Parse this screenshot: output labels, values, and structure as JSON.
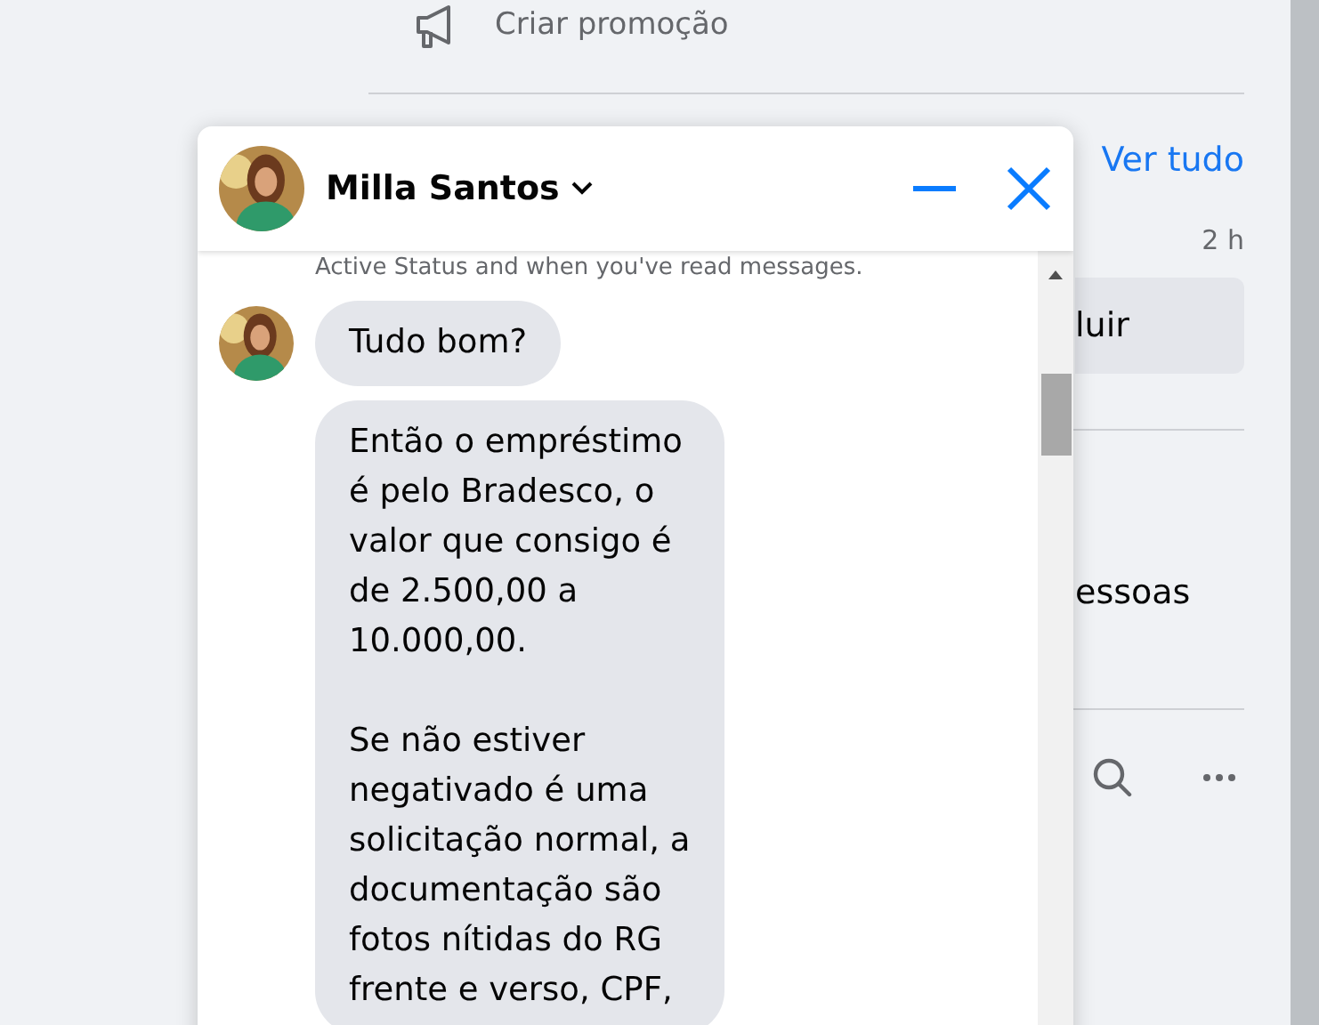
{
  "page": {
    "promo": "Criar promoção",
    "see_all": "Ver tudo",
    "time": "2 h",
    "button": "luir",
    "text": "essoas"
  },
  "chat": {
    "name": "Milla Santos",
    "notice": "Active Status and when you've read messages.",
    "messages": [
      {
        "text": "Tudo bom?",
        "show_avatar": true
      },
      {
        "text": "Então o empréstimo\né pelo Bradesco, o\nvalor que consigo é\nde 2.500,00 a\n10.000,00.\n\nSe não estiver\nnegativado é uma\nsolicitação normal, a\ndocumentação são\nfotos nítidas do RG\nfrente e verso, CPF,",
        "show_avatar": false
      }
    ]
  }
}
